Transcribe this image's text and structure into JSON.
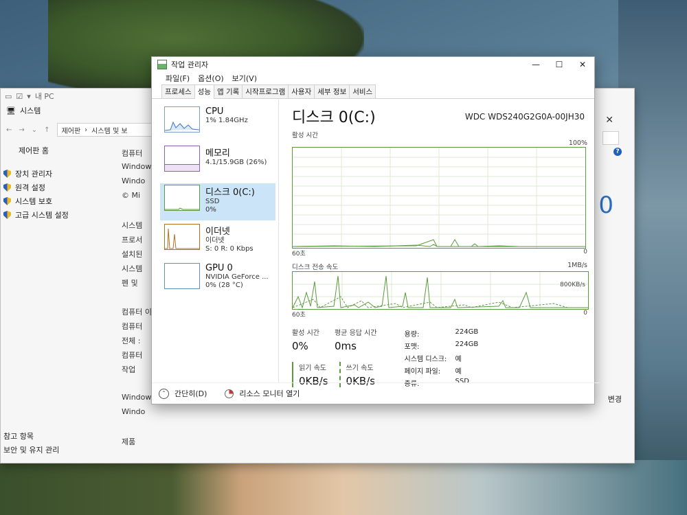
{
  "system_window": {
    "qat_title": "내 PC",
    "title": "시스템",
    "breadcrumb": [
      "제어판",
      "시스템 및 보"
    ],
    "home_link": "제어판 홈",
    "tasks": [
      "장치 관리자",
      "원격 설정",
      "시스템 보호",
      "고급 시스템 설정"
    ],
    "main_lines": [
      "컴퓨터",
      "Windows",
      "Windo",
      "© Mi",
      "",
      "시스템",
      "프로서",
      "설치된",
      "시스템",
      "펜 및",
      "",
      "컴퓨터 이",
      "컴퓨터",
      "전체 :",
      "컴퓨터",
      "작업",
      "",
      "Windows",
      "Windo",
      "",
      "제품"
    ],
    "see_also": [
      "참고 항목",
      "보안 및 유지 관리"
    ],
    "right_change": "변경",
    "right_big": "0"
  },
  "task_manager": {
    "title": "작업 관리자",
    "menu": [
      "파일(F)",
      "옵션(O)",
      "보기(V)"
    ],
    "tabs": [
      "프로세스",
      "성능",
      "앱 기록",
      "시작프로그램",
      "사용자",
      "세부 정보",
      "서비스"
    ],
    "active_tab": "성능",
    "side": [
      {
        "name": "CPU",
        "sub1": "1% 1.84GHz",
        "sub2": ""
      },
      {
        "name": "메모리",
        "sub1": "4.1/15.9GB (26%)",
        "sub2": ""
      },
      {
        "name": "디스크 0(C:)",
        "sub1": "SSD",
        "sub2": "0%"
      },
      {
        "name": "이더넷",
        "sub1": "이더넷",
        "sub2": "S: 0 R: 0 Kbps"
      },
      {
        "name": "GPU 0",
        "sub1": "NVIDIA GeForce ...",
        "sub2": "0% (28 °C)"
      }
    ],
    "detail": {
      "title": "디스크 0(C:)",
      "model": "WDC WDS240G2G0A-00JH30",
      "graph1": {
        "label": "활성 시간",
        "max": "100%",
        "left_foot": "60초",
        "right_foot": "0"
      },
      "graph2": {
        "label": "디스크 전송 속도",
        "max": "1MB/s",
        "mid": "800KB/s",
        "left_foot": "60초",
        "right_foot": "0"
      },
      "active_time_label": "활성 시간",
      "active_time_value": "0%",
      "resp_label": "평균 응답 시간",
      "resp_value": "0ms",
      "read_label": "읽기 속도",
      "read_value": "0KB/s",
      "write_label": "쓰기 속도",
      "write_value": "0KB/s",
      "props": [
        [
          "용량:",
          "224GB"
        ],
        [
          "포맷:",
          "224GB"
        ],
        [
          "시스템 디스크:",
          "예"
        ],
        [
          "페이지 파일:",
          "예"
        ],
        [
          "종류:",
          "SSD"
        ]
      ]
    },
    "footer": {
      "fewer": "간단히(D)",
      "resmon": "리소스 모니터 열기"
    },
    "colors": {
      "disk": "#5a9a3c",
      "selected": "#cce4f7"
    }
  }
}
